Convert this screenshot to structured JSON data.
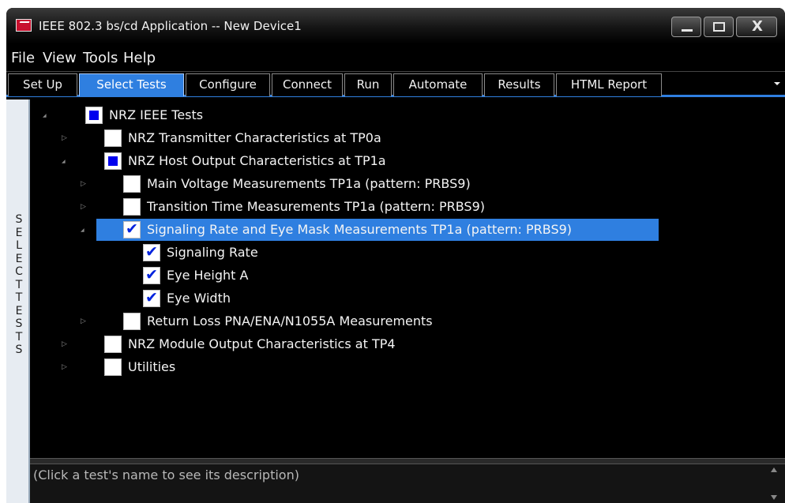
{
  "window": {
    "title": "IEEE 802.3 bs/cd Application -- New Device1",
    "minimize_icon": "minimize-icon",
    "maximize_icon": "maximize-icon",
    "close_icon": "close-icon",
    "close_glyph": "X"
  },
  "menu": [
    "File",
    "View",
    "Tools",
    "Help"
  ],
  "tabs": [
    {
      "label": "Set Up",
      "active": false
    },
    {
      "label": "Select Tests",
      "active": true
    },
    {
      "label": "Configure",
      "active": false
    },
    {
      "label": "Connect",
      "active": false
    },
    {
      "label": "Run",
      "active": false
    },
    {
      "label": "Automate",
      "active": false
    },
    {
      "label": "Results",
      "active": false
    },
    {
      "label": "HTML Report",
      "active": false
    }
  ],
  "side_label": "SELECT TESTS",
  "tree": [
    {
      "label": "NRZ IEEE Tests",
      "state": "partial",
      "expander": "expanded"
    },
    {
      "label": "NRZ Transmitter Characteristics at TP0a",
      "state": "unchecked",
      "expander": "collapsed"
    },
    {
      "label": "NRZ Host Output Characteristics at TP1a",
      "state": "partial",
      "expander": "expanded"
    },
    {
      "label": "Main Voltage Measurements TP1a (pattern: PRBS9)",
      "state": "unchecked",
      "expander": "collapsed"
    },
    {
      "label": "Transition Time Measurements TP1a (pattern: PRBS9)",
      "state": "unchecked",
      "expander": "collapsed"
    },
    {
      "label": "Signaling Rate and Eye Mask Measurements TP1a (pattern: PRBS9)",
      "state": "checked",
      "expander": "expanded",
      "selected": true
    },
    {
      "label": "Signaling Rate",
      "state": "checked",
      "expander": "none"
    },
    {
      "label": "Eye Height A",
      "state": "checked",
      "expander": "none"
    },
    {
      "label": "Eye Width",
      "state": "checked",
      "expander": "none"
    },
    {
      "label": "Return Loss PNA/ENA/N1055A Measurements",
      "state": "unchecked",
      "expander": "collapsed"
    },
    {
      "label": "NRZ Module Output Characteristics at TP4",
      "state": "unchecked",
      "expander": "collapsed"
    },
    {
      "label": "Utilities",
      "state": "unchecked",
      "expander": "collapsed"
    }
  ],
  "description": "(Click a test's name to see its description)",
  "colors": {
    "accent": "#2f7fe0",
    "background": "#000000",
    "check_mark": "#0022dd",
    "partial_fill": "#0000ee"
  }
}
